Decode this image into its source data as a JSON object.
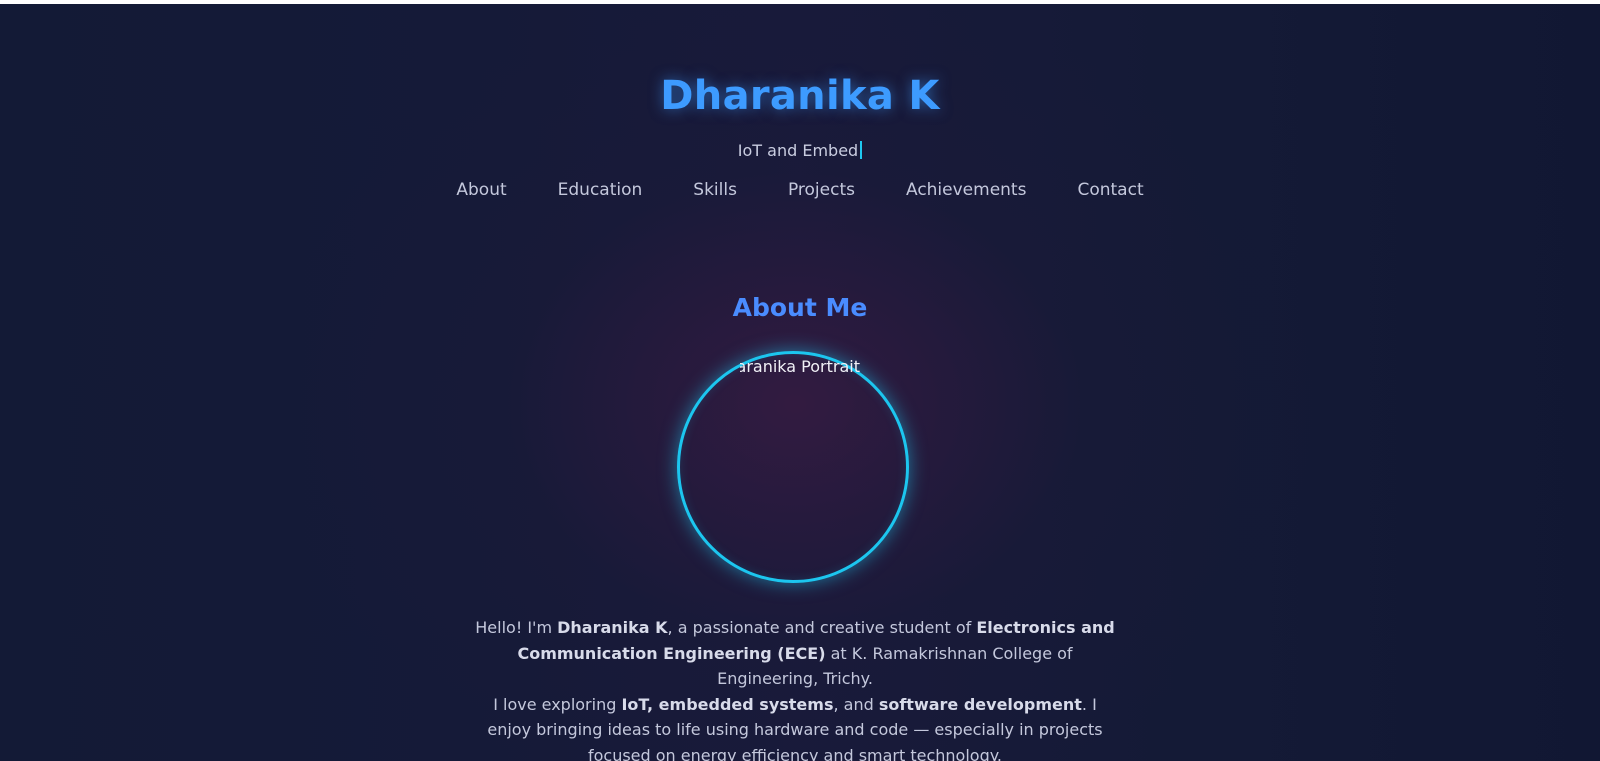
{
  "header": {
    "title": "Dharanika K",
    "tagline": "IoT and Embed"
  },
  "nav": {
    "items": [
      {
        "label": "About"
      },
      {
        "label": "Education"
      },
      {
        "label": "Skills"
      },
      {
        "label": "Projects"
      },
      {
        "label": "Achievements"
      },
      {
        "label": "Contact"
      }
    ]
  },
  "about": {
    "heading": "About Me",
    "portrait_alt": "Dharanika Portrait",
    "paragraph1": {
      "t1": "Hello! I'm ",
      "name": "Dharanika K",
      "t2": ", a passionate and creative student of ",
      "dept": "Electronics and Communication Engineering (ECE)",
      "t3": " at K. Ramakrishnan College of Engineering, Trichy."
    },
    "paragraph2": {
      "t1": "I love exploring ",
      "topics": "IoT, embedded systems",
      "t2": ", and ",
      "topic2": "software development",
      "t3": ". I enjoy bringing ideas to life using hardware and code — especially in projects focused on energy efficiency and smart technology."
    }
  },
  "colors": {
    "accent": "#3d9bff",
    "heading": "#4a8cff",
    "ring": "#1cc6ef",
    "background": "#151a38"
  }
}
